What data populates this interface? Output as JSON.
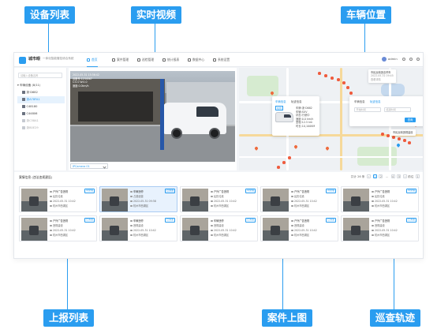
{
  "callouts": {
    "device_list": "设备列表",
    "live_video": "实时视频",
    "vehicle_position": "车辆位置",
    "report_list": "上报列表",
    "case_map": "案件上图",
    "patrol_track": "巡查轨迹"
  },
  "topbar": {
    "brand": "城市眼",
    "subtitle": "一体化智能管控综合系统",
    "nav": [
      "首页",
      "案件管理",
      "巡检管理",
      "统计报表",
      "数据中心",
      "系统设置"
    ],
    "user": "admin"
  },
  "sidebar": {
    "search_placeholder": "请输入设备名称",
    "root": "车辆设备 (8/11)",
    "items": [
      "浙·D682",
      "浙A78FA1",
      "C48180",
      "C44806",
      "浙C58A1",
      "浙B0E29"
    ]
  },
  "video": {
    "osd": [
      "2022-05-31 15:36:42",
      "设备号:1234567",
      "C:0.0  W:0.0",
      "速度:0.0km/h"
    ],
    "channel": "IPCamera 01"
  },
  "map": {
    "popup": {
      "tabs": [
        "车辆信息",
        "轨迹信息"
      ],
      "status": "在线",
      "fields": [
        {
          "k": "车牌:",
          "v": "浙·D682"
        },
        {
          "k": "车辆:",
          "v": "SUV"
        },
        {
          "k": "状态:",
          "v": "行驶中"
        },
        {
          "k": "速度:",
          "v": "0.0 km/h"
        },
        {
          "k": "里程:",
          "v": "12.5 km"
        },
        {
          "k": "时长:",
          "v": "10,100KM"
        }
      ]
    },
    "search_popup": {
      "tabs": [
        "车辆信息",
        "轨迹信息"
      ],
      "start_placeholder": "开始时间",
      "end_placeholder": "结束时间",
      "query": "查询"
    },
    "tag_top": {
      "title": "市民反映违法停车",
      "line1": "2022-05-31 09:45",
      "line2": "查看详情"
    },
    "tag_right": "市民反映违规建设"
  },
  "bottom": {
    "title": "案情信息 (违法违规建设)",
    "pager_total": "共计 26 条",
    "pages": [
      "1",
      "2",
      "...",
      "4",
      "5"
    ],
    "pager_goto": "前往"
  },
  "cards": [
    {
      "title": "户外广告违规",
      "sub": "乱扔垃圾",
      "tag": "待受理",
      "time": "2022-05-31 10:42",
      "addr": "杭州市西湖区",
      "sel": false
    },
    {
      "title": "车辆违停",
      "sub": "占道经营",
      "tag": "已派遣",
      "time": "2022-05-31 09:38",
      "addr": "杭州市西湖区",
      "sel": true
    },
    {
      "title": "户外广告违规",
      "sub": "乱扔垃圾",
      "tag": "待受理",
      "time": "2022-05-31 10:42",
      "addr": "杭州市西湖区",
      "sel": false
    },
    {
      "title": "户外广告违规",
      "sub": "乱扔垃圾",
      "tag": "待受理",
      "time": "2022-05-31 10:42",
      "addr": "杭州市西湖区",
      "sel": false
    },
    {
      "title": "户外广告违规",
      "sub": "乱扔垃圾",
      "tag": "待受理",
      "time": "2022-05-31 10:42",
      "addr": "杭州市西湖区",
      "sel": false
    },
    {
      "title": "户外广告违规",
      "sub": "违规建设",
      "tag": "已派遣",
      "time": "2022-05-31 10:42",
      "addr": "杭州市西湖区",
      "sel": false
    },
    {
      "title": "车辆违停",
      "sub": "违规建设",
      "tag": "已派遣",
      "time": "2022-05-31 10:42",
      "addr": "杭州市西湖区",
      "sel": false
    },
    {
      "title": "车辆违停",
      "sub": "违规建设",
      "tag": "已派遣",
      "time": "2022-05-31 10:42",
      "addr": "杭州市西湖区",
      "sel": false
    },
    {
      "title": "户外广告违规",
      "sub": "违规建设",
      "tag": "已派遣",
      "time": "2022-05-31 10:42",
      "addr": "杭州市西湖区",
      "sel": false
    },
    {
      "title": "户外广告违规",
      "sub": "违规建设",
      "tag": "已派遣",
      "time": "2022-05-31 10:42",
      "addr": "杭州市西湖区",
      "sel": false
    }
  ]
}
